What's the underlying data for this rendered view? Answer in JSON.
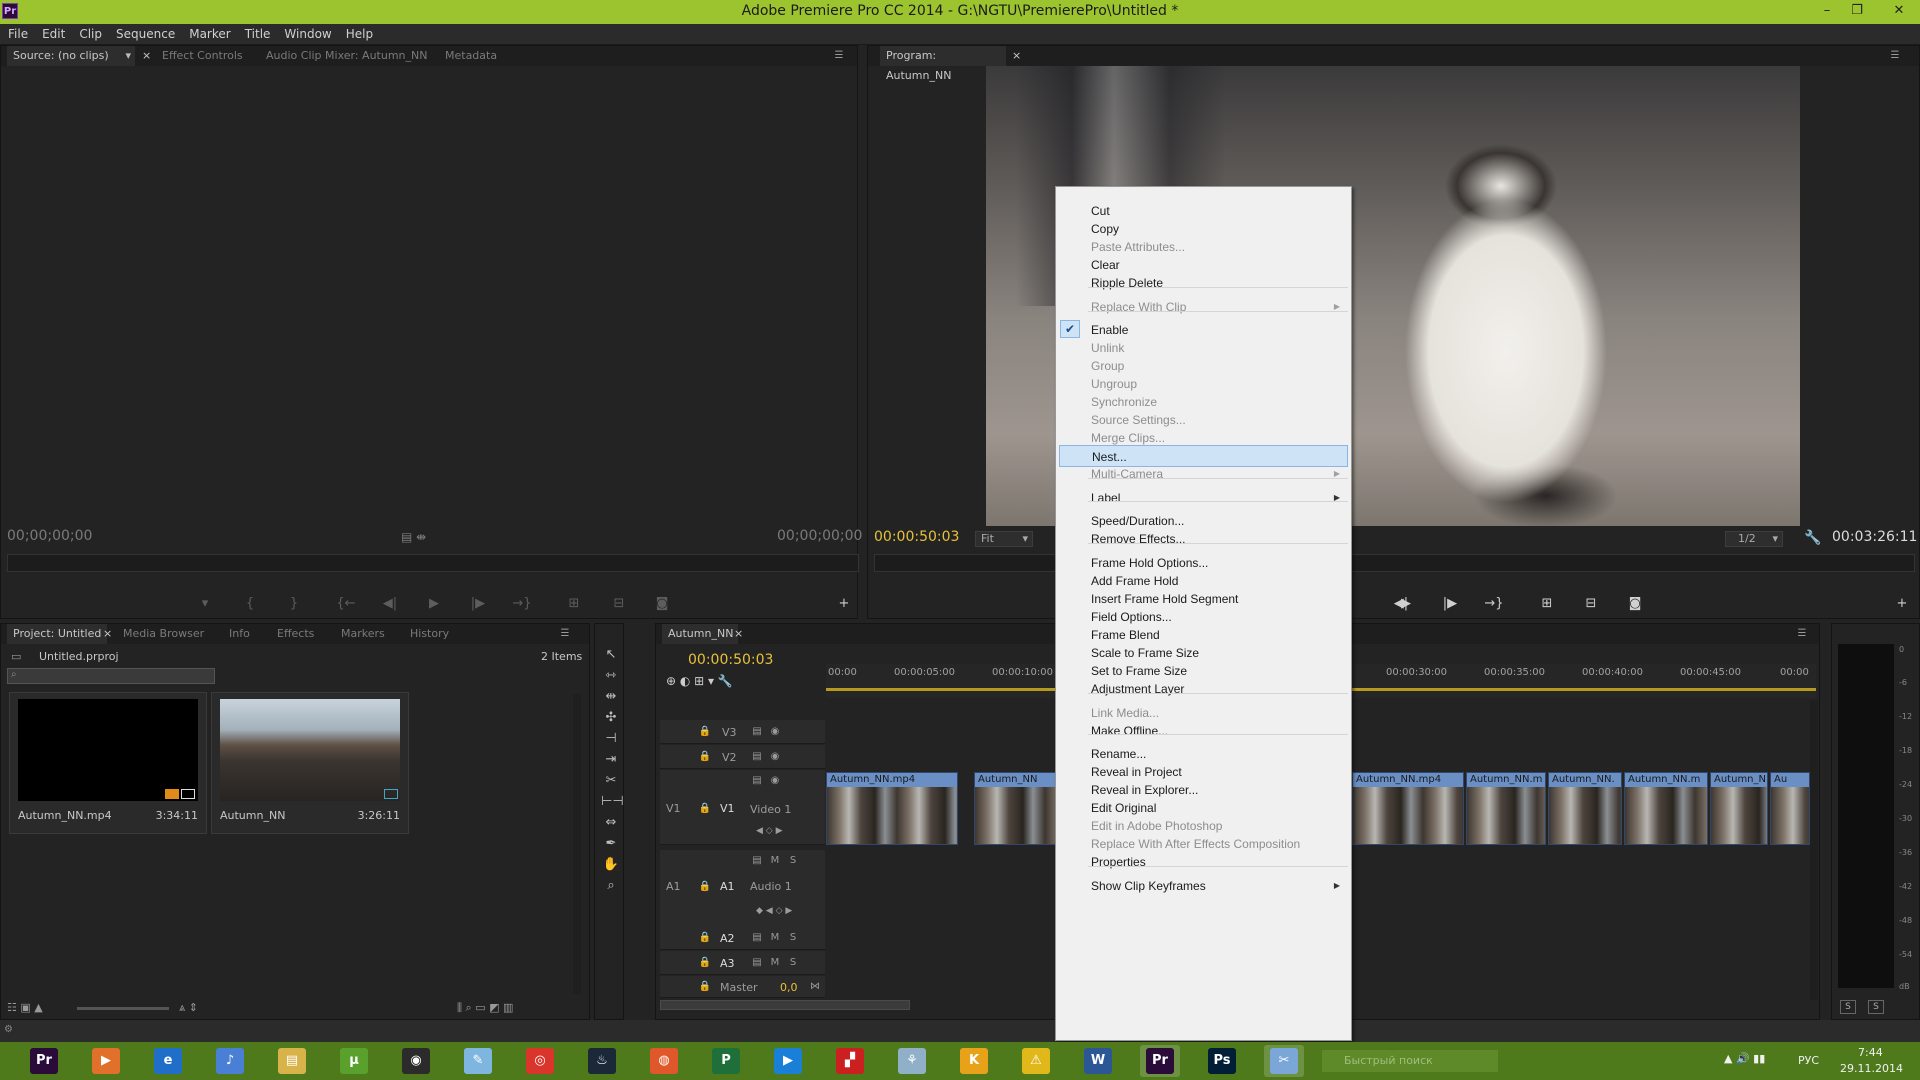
{
  "window": {
    "app_icon": "Pr",
    "title": "Adobe Premiere Pro CC 2014 - G:\\NGTU\\PremierePro\\Untitled *",
    "controls": [
      "–",
      "❐",
      "✕"
    ]
  },
  "menubar": [
    "File",
    "Edit",
    "Clip",
    "Sequence",
    "Marker",
    "Title",
    "Window",
    "Help"
  ],
  "source_panel": {
    "tabs": [
      "Source: (no clips)",
      "Effect Controls",
      "Audio Clip Mixer: Autumn_NN",
      "Metadata"
    ],
    "timecode_left": "00;00;00;00",
    "timecode_right": "00;00;00;00"
  },
  "program_panel": {
    "tab": "Program: Autumn_NN",
    "timecode": "00:00:50:03",
    "fit": "Fit",
    "resolution": "1/2",
    "duration": "00:03:26:11"
  },
  "project_panel": {
    "tabs": [
      "Project: Untitled",
      "Media Browser",
      "Info",
      "Effects",
      "Markers",
      "History"
    ],
    "file": "Untitled.prproj",
    "item_count": "2 Items",
    "items": [
      {
        "name": "Autumn_NN.mp4",
        "duration": "3:34:11"
      },
      {
        "name": "Autumn_NN",
        "duration": "3:26:11"
      }
    ]
  },
  "timeline": {
    "tab": "Autumn_NN",
    "timecode": "00:00:50:03",
    "ruler": [
      "00:00",
      "00:00:05:00",
      "00:00:10:00",
      "00:00:30:00",
      "00:00:35:00",
      "00:00:40:00",
      "00:00:45:00",
      "00:00"
    ],
    "video_tracks": [
      "V3",
      "V2",
      "V1"
    ],
    "video1_name": "Video 1",
    "audio_tracks": [
      "A1",
      "A2",
      "A3"
    ],
    "audio1_name": "Audio 1",
    "master": "Master",
    "master_value": "0,0",
    "src_v1": "V1",
    "src_a1": "A1",
    "track_m": "M",
    "track_s": "S",
    "clips": [
      "Autumn_NN.mp4",
      "Autumn_NN",
      "Autumn_NN.mp4",
      "Autumn_NN.m",
      "Autumn_NN.",
      "Autumn_NN.m",
      "Autumn_N",
      "Au"
    ]
  },
  "context_menu": {
    "items": [
      {
        "label": "Cut",
        "enabled": true
      },
      {
        "label": "Copy",
        "enabled": true
      },
      {
        "label": "Paste Attributes...",
        "enabled": false
      },
      {
        "label": "Clear",
        "enabled": true
      },
      {
        "label": "Ripple Delete",
        "enabled": true
      },
      {
        "label": "Replace With Clip",
        "enabled": false,
        "submenu": true
      },
      {
        "label": "Enable",
        "enabled": true,
        "checked": true
      },
      {
        "label": "Unlink",
        "enabled": false
      },
      {
        "label": "Group",
        "enabled": false
      },
      {
        "label": "Ungroup",
        "enabled": false
      },
      {
        "label": "Synchronize",
        "enabled": false
      },
      {
        "label": "Source Settings...",
        "enabled": false
      },
      {
        "label": "Merge Clips...",
        "enabled": false
      },
      {
        "label": "Nest...",
        "enabled": true,
        "highlighted": true
      },
      {
        "label": "Multi-Camera",
        "enabled": false,
        "submenu": true
      },
      {
        "label": "Label",
        "enabled": true,
        "submenu": true
      },
      {
        "label": "Speed/Duration...",
        "enabled": true
      },
      {
        "label": "Remove Effects...",
        "enabled": true
      },
      {
        "label": "Frame Hold Options...",
        "enabled": true
      },
      {
        "label": "Add Frame Hold",
        "enabled": true
      },
      {
        "label": "Insert Frame Hold Segment",
        "enabled": true
      },
      {
        "label": "Field Options...",
        "enabled": true
      },
      {
        "label": "Frame Blend",
        "enabled": true
      },
      {
        "label": "Scale to Frame Size",
        "enabled": true
      },
      {
        "label": "Set to Frame Size",
        "enabled": true
      },
      {
        "label": "Adjustment Layer",
        "enabled": true
      },
      {
        "label": "Link Media...",
        "enabled": false
      },
      {
        "label": "Make Offline...",
        "enabled": true
      },
      {
        "label": "Rename...",
        "enabled": true
      },
      {
        "label": "Reveal in Project",
        "enabled": true
      },
      {
        "label": "Reveal in Explorer...",
        "enabled": true
      },
      {
        "label": "Edit Original",
        "enabled": true
      },
      {
        "label": "Edit in Adobe Photoshop",
        "enabled": false
      },
      {
        "label": "Replace With After Effects Composition",
        "enabled": false
      },
      {
        "label": "Properties",
        "enabled": true
      },
      {
        "label": "Show Clip Keyframes",
        "enabled": true,
        "submenu": true
      }
    ]
  },
  "audio_meter": {
    "labels": [
      "0",
      "-6",
      "-12",
      "-18",
      "-24",
      "-30",
      "-36",
      "-42",
      "-48",
      "-54",
      "dB"
    ],
    "solo": [
      "S",
      "S"
    ]
  },
  "taskbar": {
    "search_placeholder": "Быстрый поиск",
    "lang": "РУС",
    "time": "7:44",
    "date": "29.11.2014",
    "apps": [
      "Pr",
      "▶",
      "e",
      "♪",
      "▤",
      "µ",
      "◉",
      "✎",
      "◎",
      "♨",
      "◍",
      "P",
      "▶",
      "▞",
      "⚘",
      "K",
      "⚠",
      "W",
      "Pr",
      "Ps",
      "✂"
    ]
  }
}
